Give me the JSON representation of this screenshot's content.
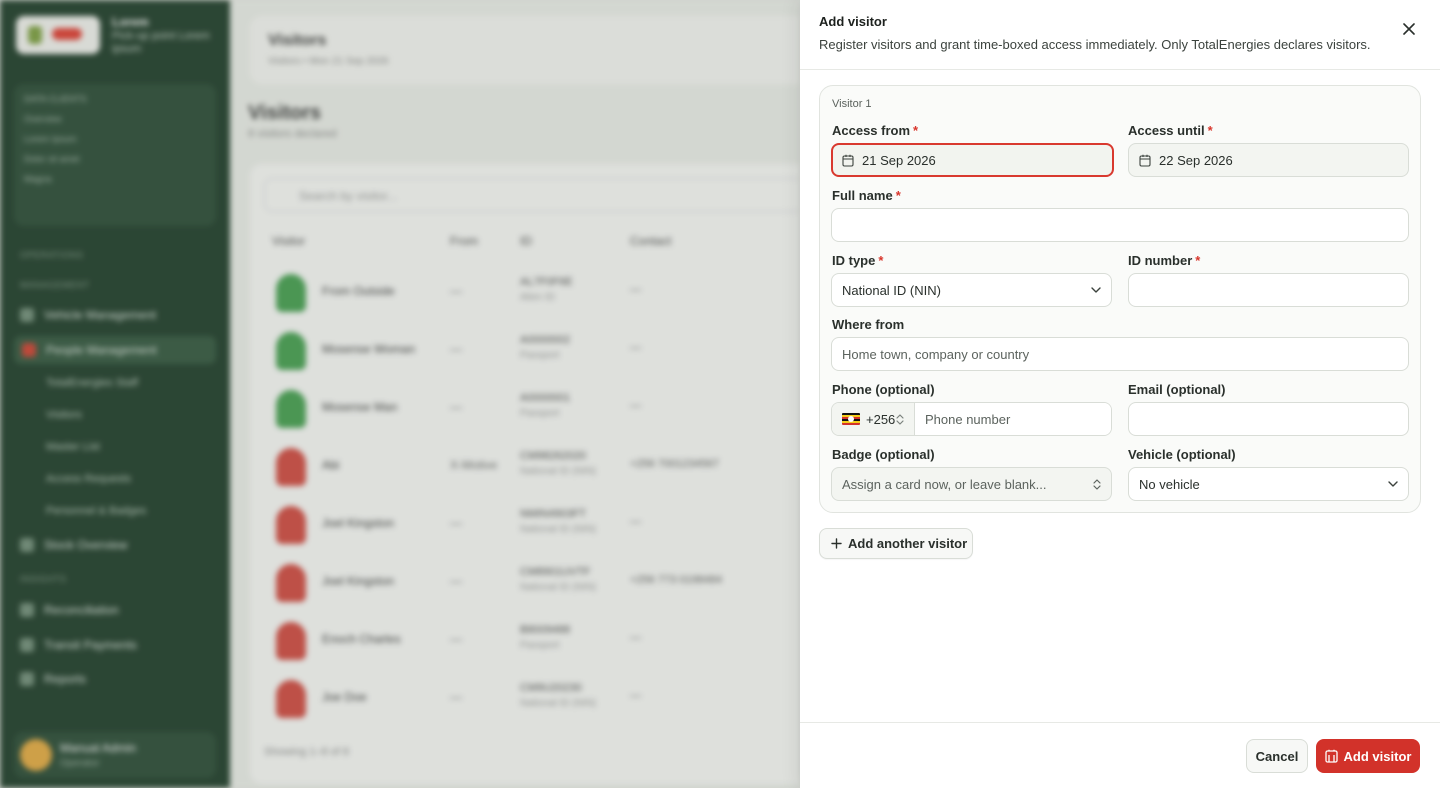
{
  "background": {
    "org": {
      "name": "Lorem",
      "line": "Pick-up point Lorem ipsum"
    },
    "card": {
      "title": "DATA CLIENTS",
      "rows": [
        "Overview",
        "Lorem Ipsum",
        "Dolor sit amet",
        "Magna"
      ]
    },
    "sections": [
      "OPERATIONS",
      "MANAGEMENT",
      "INSIGHTS"
    ],
    "nav": {
      "vehicle": "Vehicle Management",
      "people": "People Management",
      "staff": "TotalEnergies Staff",
      "visitors": "Visitors",
      "master": "Master List",
      "access": "Access Requests",
      "personnel": "Personnel & Badges",
      "stock": "Stock Overview",
      "reconciliation": "Reconciliation",
      "transit": "Transit Payments",
      "reports": "Reports"
    },
    "user": {
      "name": "Manual Admin",
      "role": "Operator"
    },
    "header": {
      "title": "Visitors",
      "sub": "Visitors • Mon 21 Sep 2026"
    },
    "page": {
      "title": "Visitors",
      "sub": "8 visitors declared"
    },
    "search_placeholder": "Search by visitor...",
    "columns": [
      "Visitor",
      "From",
      "ID",
      "Contact"
    ],
    "rows": [
      {
        "name": "From Outside",
        "from": "—",
        "id": "AL7F0F6E",
        "id_type": "Alien ID",
        "contact": "—",
        "color": "green"
      },
      {
        "name": "Mosense Woman",
        "from": "—",
        "id": "A0000002",
        "id_type": "Passport",
        "contact": "—",
        "color": "green"
      },
      {
        "name": "Mosense Man",
        "from": "—",
        "id": "A0000001",
        "id_type": "Passport",
        "contact": "—",
        "color": "green"
      },
      {
        "name": "Abi",
        "from": "X-Motive",
        "id": "CM98262020",
        "id_type": "National ID (NIN)",
        "contact": "+256 7001234567",
        "color": "red"
      },
      {
        "name": "Joel Kingston",
        "from": "—",
        "id": "NMIN4903FT",
        "id_type": "National ID (NIN)",
        "contact": "—",
        "color": "red"
      },
      {
        "name": "Joel Kingston",
        "from": "—",
        "id": "CM8901UVTF",
        "id_type": "National ID (NIN)",
        "contact": "+256 773 0198484",
        "color": "red"
      },
      {
        "name": "Enoch Charles",
        "from": "—",
        "id": "B8009488",
        "id_type": "Passport",
        "contact": "—",
        "color": "red"
      },
      {
        "name": "Joe Doe",
        "from": "—",
        "id": "CM9U20230",
        "id_type": "National ID (NIN)",
        "contact": "—",
        "color": "red"
      }
    ],
    "footer": "Showing 1–8 of 8"
  },
  "drawer": {
    "title": "Add visitor",
    "description": "Register visitors and grant time-boxed access immediately. Only TotalEnergies declares visitors.",
    "visitor_label": "Visitor 1",
    "access_from": {
      "label": "Access from",
      "value": "21 Sep 2026"
    },
    "access_until": {
      "label": "Access until",
      "value": "22 Sep 2026"
    },
    "full_name": {
      "label": "Full name",
      "value": ""
    },
    "id_type": {
      "label": "ID type",
      "value": "National ID (NIN)"
    },
    "id_number": {
      "label": "ID number",
      "value": ""
    },
    "where_from": {
      "label": "Where from",
      "placeholder": "Home town, company or country"
    },
    "phone": {
      "label": "Phone (optional)",
      "code": "+256",
      "placeholder": "Phone number"
    },
    "email": {
      "label": "Email (optional)",
      "value": ""
    },
    "badge": {
      "label": "Badge (optional)",
      "placeholder": "Assign a card now, or leave blank..."
    },
    "vehicle": {
      "label": "Vehicle (optional)",
      "value": "No vehicle"
    },
    "required_mark": "*",
    "add_another": "Add another visitor",
    "cancel": "Cancel",
    "submit": "Add visitor"
  },
  "colors": {
    "accent": "#d2322a",
    "error_border": "#d9392f",
    "sidebar": "#173622"
  }
}
